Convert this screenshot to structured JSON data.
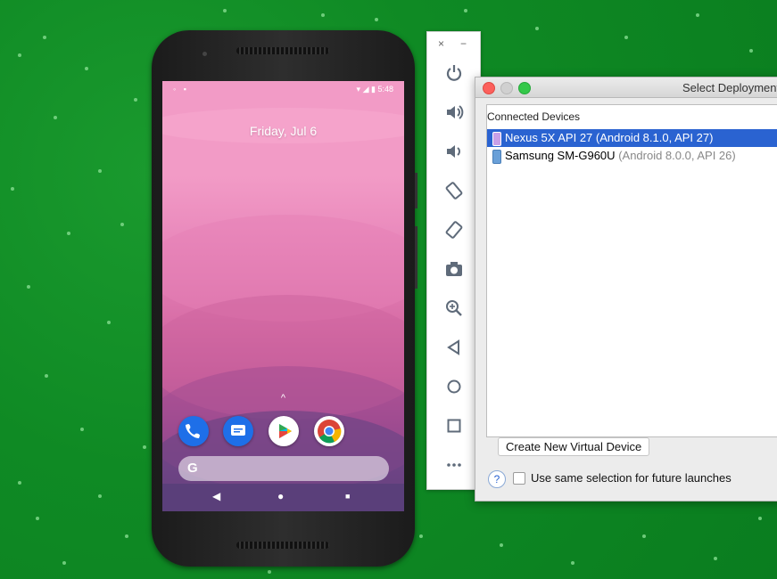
{
  "emulator": {
    "status_time": "5:48",
    "date_text": "Friday, Jul 6",
    "up_arrow": "^",
    "search_glyph": "G",
    "nav": {
      "back": "◀",
      "home": "●",
      "recents": "■"
    },
    "toolbar": {
      "close": "×",
      "minimize": "−",
      "icons": [
        "power-icon",
        "volume-up-icon",
        "volume-down-icon",
        "rotate-left-icon",
        "rotate-right-icon",
        "camera-icon",
        "zoom-icon",
        "back-icon",
        "home-icon",
        "overview-icon",
        "more-icon"
      ]
    },
    "dock_apps": [
      {
        "name": "phone-app-icon",
        "color": "#1e6fe8"
      },
      {
        "name": "messages-app-icon",
        "color": "#1e6fe8"
      },
      {
        "name": "play-store-app-icon",
        "color": "#ffffff"
      },
      {
        "name": "chrome-app-icon",
        "color": "#ffffff"
      }
    ]
  },
  "dialog": {
    "title": "Select Deployment Target",
    "list_header": "Connected Devices",
    "devices": [
      {
        "name": "Nexus 5X API 27",
        "detail": "(Android 8.1.0, API 27)",
        "selected": true
      },
      {
        "name": "Samsung SM-G960U",
        "detail": "(Android 8.0.0, API 26)",
        "selected": false
      }
    ],
    "create_button": "Create New Virtual Device",
    "help": "?",
    "checkbox_label": "Use same selection for future launches"
  },
  "colors": {
    "selection": "#2a63d1",
    "background": "#0f8a24"
  }
}
